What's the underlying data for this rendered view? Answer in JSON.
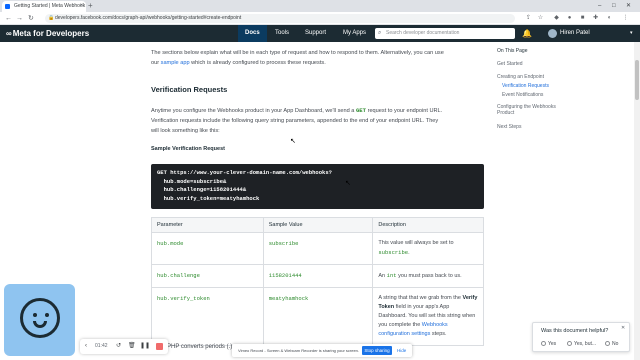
{
  "browser": {
    "tab_title": "Getting Started | Meta Webhook",
    "new_tab": "+",
    "url": "developers.facebook.com/docs/graph-api/webhooks/getting-started#create-endpoint"
  },
  "header": {
    "logo": "Meta for Developers",
    "nav": [
      "Docs",
      "Tools",
      "Support",
      "My Apps"
    ],
    "search_placeholder": "Search developer documentation",
    "user": "Hiren Patel"
  },
  "content": {
    "intro_line1_pre": "The sections below explain what will be in each type of request and how to respond to them. Alternatively, you can use",
    "intro_line2_pre": "our ",
    "intro_link": "sample app",
    "intro_line2_post": " which is already configured to process these requests.",
    "heading": "Verification Requests",
    "para1_pre": "Anytime you configure the Webhooks product in your App Dashboard, we'll send a ",
    "para1_code": "GET",
    "para1_post": " request to your endpoint URL.",
    "para2": "Verification requests include the following query string parameters, appended to the end of your endpoint URL. They",
    "para3": "will look something like this:",
    "subheading": "Sample Verification Request",
    "code_lines": [
      "GET https://www.your-clever-domain-name.com/webhooks?",
      "  hub.mode=subscribe&",
      "  hub.challenge=1158201444&",
      "  hub.verify_token=meatyhamhock"
    ],
    "table_headers": [
      "Parameter",
      "Sample Value",
      "Description"
    ],
    "rows": [
      {
        "param": "hub.mode",
        "value": "subscribe",
        "desc_pre": "This value will always be set to ",
        "desc_code": "subscribe",
        "desc_post": "."
      },
      {
        "param": "hub.challenge",
        "value": "1158201444",
        "desc_pre": "An ",
        "desc_code": "int",
        "desc_post": " you must pass back to us."
      },
      {
        "param": "hub.verify_token",
        "value": "meatyhamhock",
        "desc_pre": "A string that that we grab from the ",
        "desc_bold": "Verify Token",
        "desc_mid": " field in your app's App Dashboard. You will set this string when you complete the ",
        "desc_link": "Webhooks configuration settings",
        "desc_post": " steps."
      }
    ],
    "note": "Note: PHP converts periods (.)"
  },
  "toc": {
    "items": [
      "On This Page",
      "Get Started",
      "Creating an Endpoint",
      "Verification Requests",
      "Event Notifications",
      "Configuring the Webhooks Product",
      "Next Steps"
    ]
  },
  "recorder": {
    "time": "01:42",
    "share_msg": "Vimeo Record - Screen & Webcam Recorder is sharing your screen.",
    "stop_sharing": "Stop sharing",
    "hide": "Hide"
  },
  "feedback": {
    "question": "Was this document helpful?",
    "options": [
      "Yes",
      "Yes, but...",
      "No"
    ]
  },
  "colors": {
    "header_bg": "#1c2b33",
    "link": "#216fdb",
    "code_green": "#2c8a2c",
    "code_bg": "#1e2125"
  }
}
